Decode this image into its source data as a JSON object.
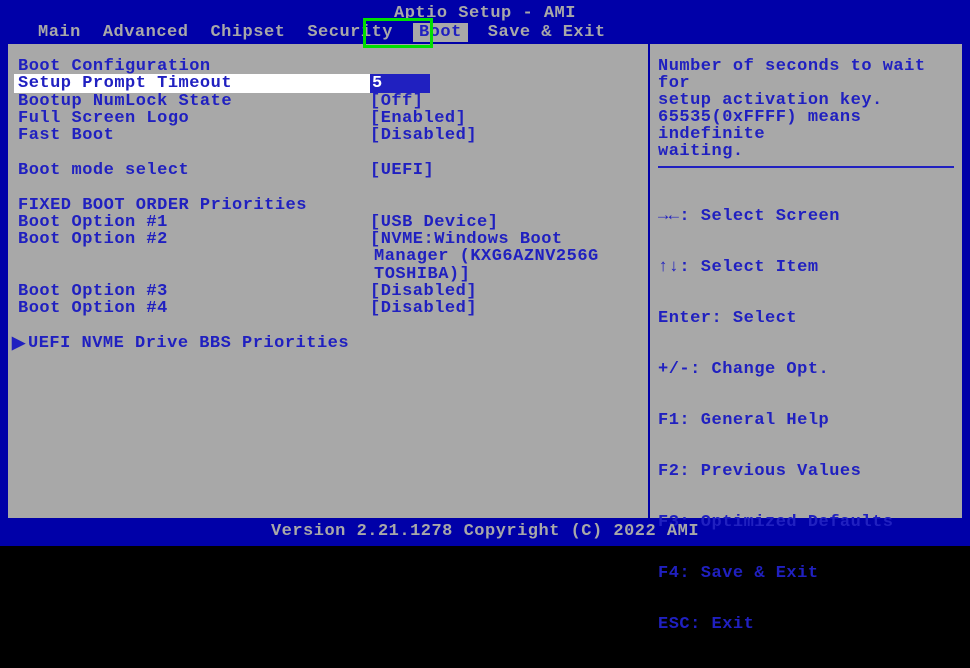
{
  "title": "Aptio Setup - AMI",
  "footer": "Version 2.21.1278 Copyright (C) 2022 AMI",
  "menu": {
    "items": [
      "Main",
      "Advanced",
      "Chipset",
      "Security",
      "Boot",
      "Save & Exit"
    ],
    "active_index": 4
  },
  "sections": {
    "boot_config_header": "Boot Configuration",
    "setup_prompt": {
      "label": "Setup Prompt Timeout",
      "value": "5"
    },
    "numlock": {
      "label": "Bootup NumLock State",
      "value": "[Off]"
    },
    "fullscreen_logo": {
      "label": "Full Screen Logo",
      "value": "[Enabled]"
    },
    "fast_boot": {
      "label": "Fast Boot",
      "value": "[Disabled]"
    },
    "boot_mode": {
      "label": "Boot mode select",
      "value": "[UEFI]"
    },
    "fixed_header": "FIXED BOOT ORDER Priorities",
    "opt1": {
      "label": "Boot Option #1",
      "value": "[USB Device]"
    },
    "opt2": {
      "label": "Boot Option #2",
      "value": "[NVME:Windows Boot",
      "cont1": "Manager (KXG6AZNV256G",
      "cont2": "TOSHIBA)]"
    },
    "opt3": {
      "label": "Boot Option #3",
      "value": "[Disabled]"
    },
    "opt4": {
      "label": "Boot Option #4",
      "value": "[Disabled]"
    },
    "submenu": "UEFI NVME Drive BBS Priorities"
  },
  "help": {
    "text_l1": "Number of seconds to wait for",
    "text_l2": "setup activation key.",
    "text_l3": "65535(0xFFFF) means indefinite",
    "text_l4": "waiting.",
    "keys": {
      "select_screen": "→←: Select Screen",
      "select_item": "↑↓: Select Item",
      "enter": "Enter: Select",
      "change": "+/-: Change Opt.",
      "f1": "F1: General Help",
      "f2": "F2: Previous Values",
      "f3": "F3: Optimized Defaults",
      "f4": "F4: Save & Exit",
      "esc": "ESC: Exit"
    }
  }
}
